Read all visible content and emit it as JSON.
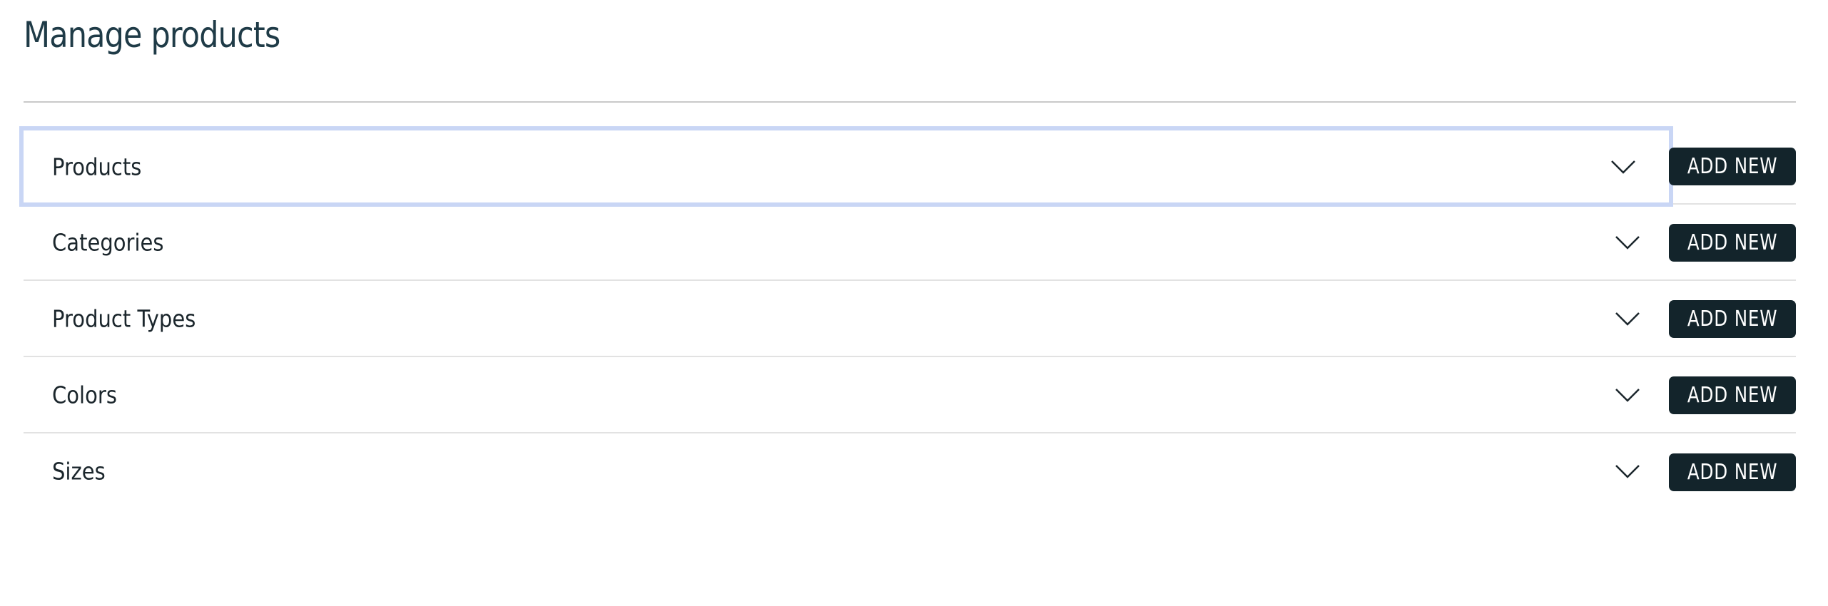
{
  "page": {
    "title": "Manage products"
  },
  "sections": [
    {
      "label": "Products",
      "action_label": "ADD NEW",
      "expanded": false,
      "focused": true
    },
    {
      "label": "Categories",
      "action_label": "ADD NEW",
      "expanded": false,
      "focused": false
    },
    {
      "label": "Product Types",
      "action_label": "ADD NEW",
      "expanded": false,
      "focused": false
    },
    {
      "label": "Colors",
      "action_label": "ADD NEW",
      "expanded": false,
      "focused": false
    },
    {
      "label": "Sizes",
      "action_label": "ADD NEW",
      "expanded": false,
      "focused": false
    }
  ],
  "icons": {
    "expand": "chevron-down-icon"
  },
  "colors": {
    "title": "#1f3b47",
    "button_bg": "#13242b",
    "button_text": "#ffffff",
    "focus_ring": "#c9d6f5",
    "divider": "#e2e2e2"
  }
}
